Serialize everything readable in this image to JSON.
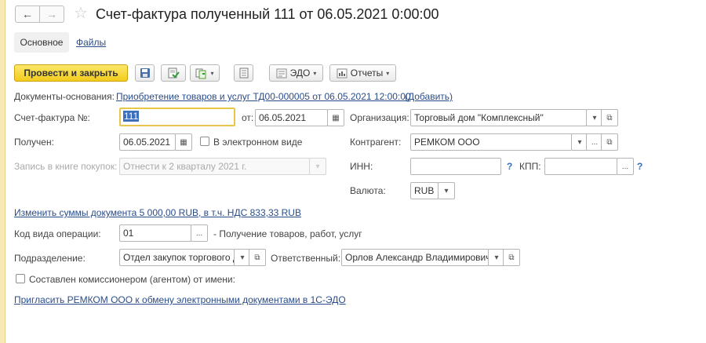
{
  "title": "Счет-фактура полученный 111 от 06.05.2021 0:00:00",
  "tabs": {
    "main": "Основное",
    "files": "Файлы"
  },
  "toolbar": {
    "post_close": "Провести и закрыть",
    "edo": "ЭДО",
    "reports": "Отчеты"
  },
  "basis": {
    "label": "Документы-основания:",
    "doc_link": "Приобретение товаров и услуг ТД00-000005 от 06.05.2021 12:00:00",
    "add_link": "(Добавить)"
  },
  "invoice": {
    "number_label": "Счет-фактура №:",
    "number_value": "111",
    "date_label": "от:",
    "date_value": "06.05.2021"
  },
  "received": {
    "label": "Получен:",
    "date_value": "06.05.2021",
    "electronic_label": "В электронном виде"
  },
  "purchase_book": {
    "label": "Запись в книге покупок:",
    "value": "Отнести к 2 кварталу 2021 г."
  },
  "organization": {
    "label": "Организация:",
    "value": "Торговый дом \"Комплексный\""
  },
  "counterparty": {
    "label": "Контрагент:",
    "value": "РЕМКОМ ООО"
  },
  "inn": {
    "label": "ИНН:",
    "value": "",
    "help": "?"
  },
  "kpp": {
    "label": "КПП:",
    "value": "",
    "help": "?"
  },
  "currency": {
    "label": "Валюта:",
    "value": "RUB"
  },
  "amounts_link": "Изменить суммы документа 5 000,00 RUB, в т.ч. НДС 833,33 RUB",
  "operation": {
    "label": "Код вида операции:",
    "code": "01",
    "description": "- Получение товаров, работ, услуг"
  },
  "department": {
    "label": "Подразделение:",
    "value": "Отдел закупок торгового д"
  },
  "responsible": {
    "label": "Ответственный:",
    "value": "Орлов Александр Владимирович"
  },
  "commission": {
    "label": "Составлен комиссионером (агентом) от имени:"
  },
  "invite_link": "Пригласить РЕМКОМ ООО к обмену электронными документами в 1С-ЭДО",
  "icons": {
    "back": "←",
    "forward": "→",
    "star": "☆",
    "dots": "...",
    "calendar": "▦",
    "open": "⧉",
    "dropdown": "▾"
  }
}
